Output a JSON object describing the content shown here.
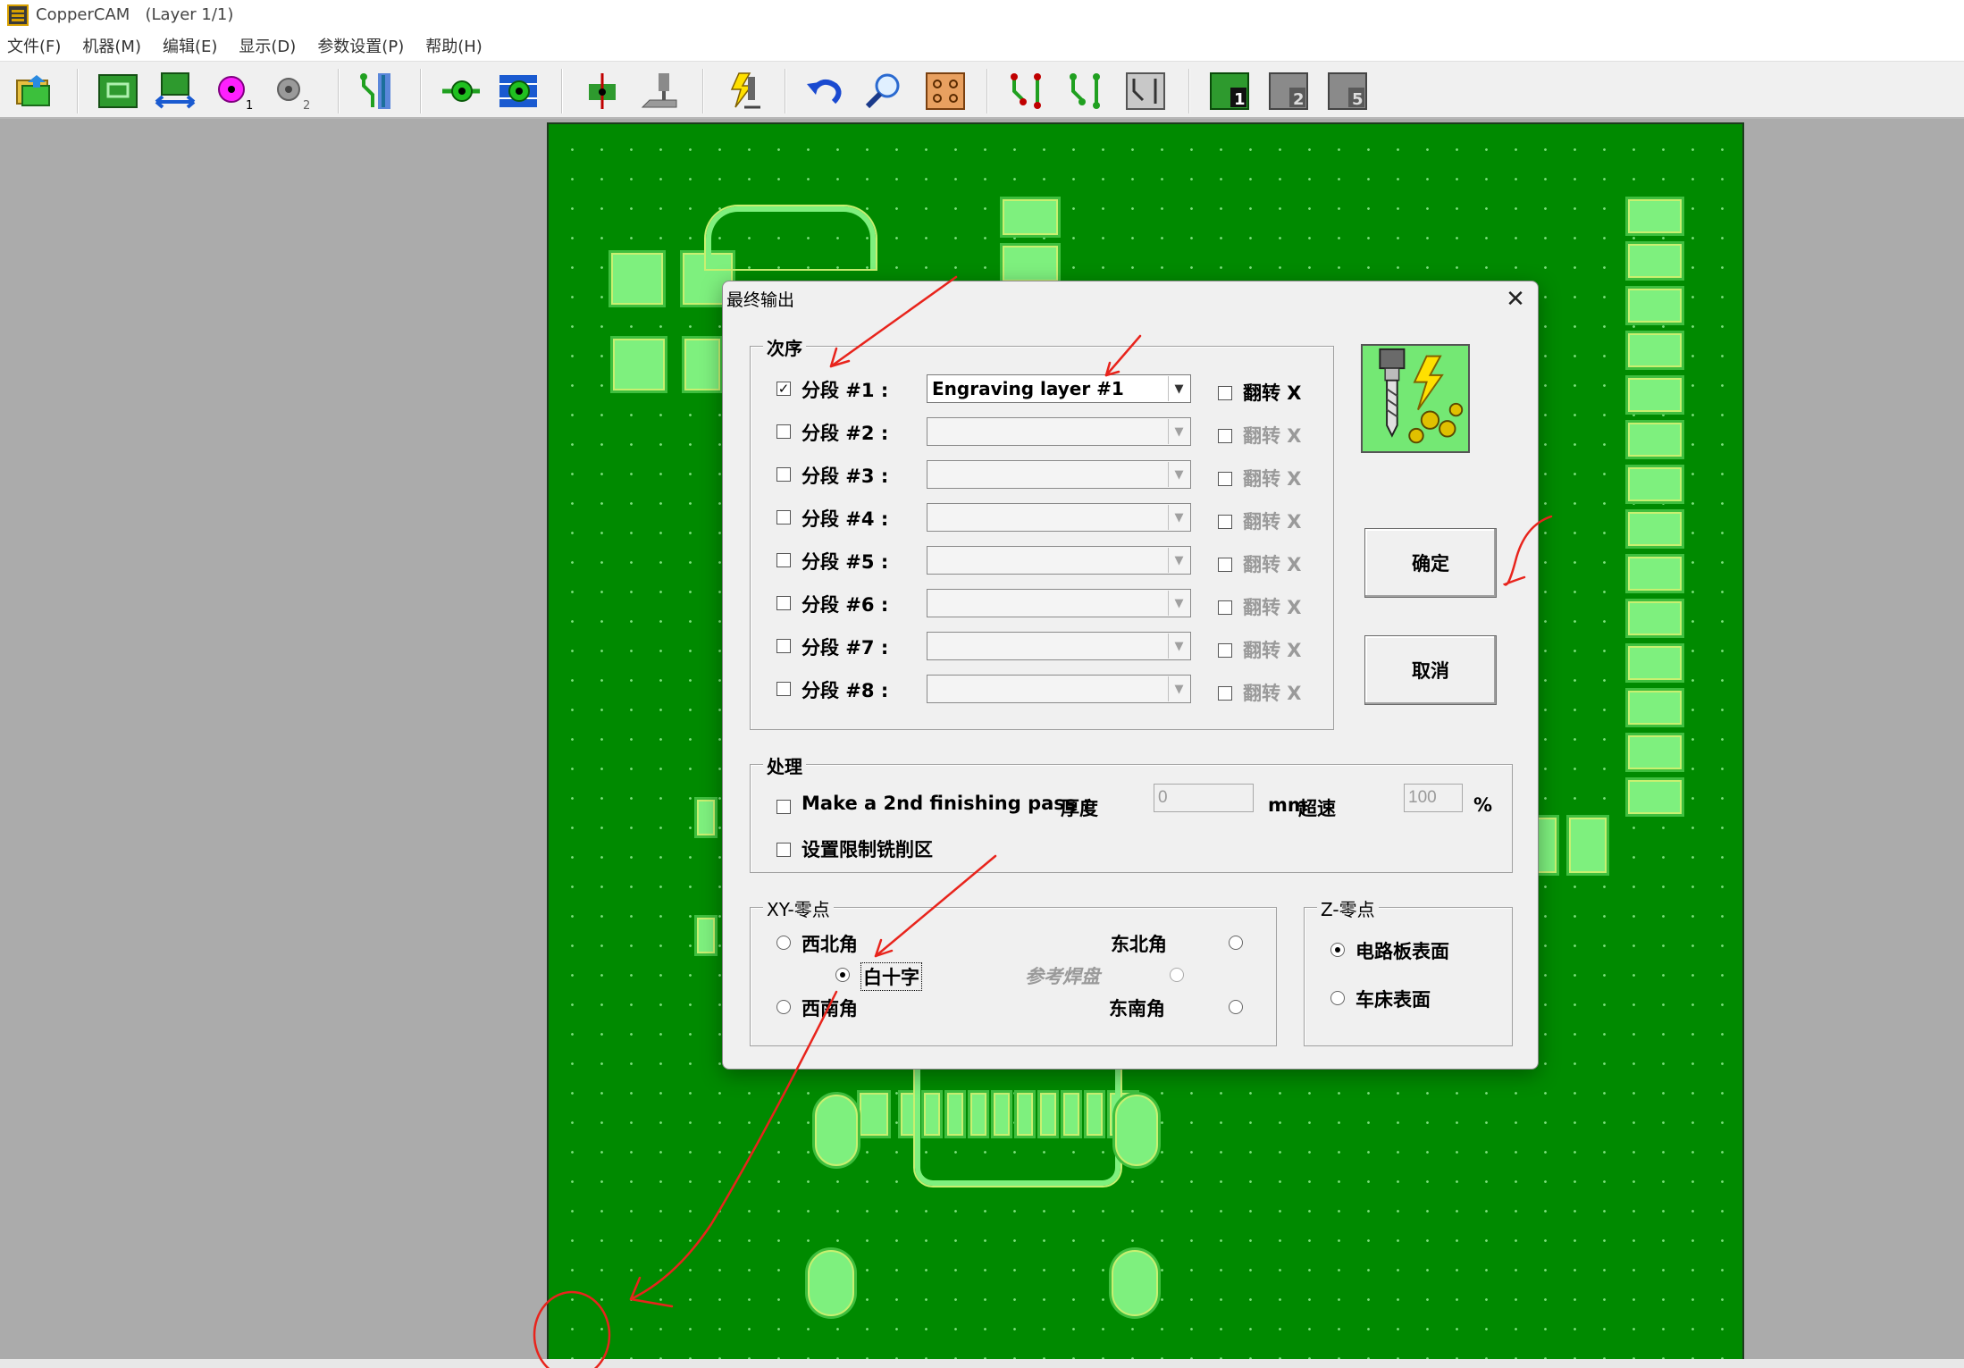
{
  "window": {
    "title": "CopperCAM   (Layer 1/1)"
  },
  "menu": [
    "文件(F)",
    "机器(M)",
    "编辑(E)",
    "显示(D)",
    "参数设置(P)",
    "帮助(H)"
  ],
  "toolbar": {
    "icons": [
      "open-folder-icon",
      "board-icon",
      "board-move-icon",
      "pad-1-icon",
      "pad-2-icon",
      "track-icon",
      "pad-drill-icon",
      "pad-contour-icon",
      "drill-icon",
      "mill-icon",
      "laser-output-icon",
      "undo-icon",
      "zoom-icon",
      "pcb-view-icon",
      "route-a-icon",
      "route-b-icon",
      "route-c-icon",
      "layer-1-icon",
      "layer-2-icon",
      "layer-5-icon"
    ],
    "badges": {
      "pad1": "1",
      "pad2": "2",
      "layer1": "1",
      "layer2": "2",
      "layer5": "5"
    }
  },
  "dialog": {
    "title": "最终输出",
    "close": "✕",
    "order_group": "次序",
    "sections": [
      {
        "label": "分段 #1 :",
        "checked": true,
        "value": "Engraving layer #1",
        "flip": "翻转 X",
        "enabled": true
      },
      {
        "label": "分段 #2 :",
        "checked": false,
        "value": "",
        "flip": "翻转 X",
        "enabled": false
      },
      {
        "label": "分段 #3 :",
        "checked": false,
        "value": "",
        "flip": "翻转 X",
        "enabled": false
      },
      {
        "label": "分段 #4 :",
        "checked": false,
        "value": "",
        "flip": "翻转 X",
        "enabled": false
      },
      {
        "label": "分段 #5 :",
        "checked": false,
        "value": "",
        "flip": "翻转 X",
        "enabled": false
      },
      {
        "label": "分段 #6 :",
        "checked": false,
        "value": "",
        "flip": "翻转 X",
        "enabled": false
      },
      {
        "label": "分段 #7 :",
        "checked": false,
        "value": "",
        "flip": "翻转 X",
        "enabled": false
      },
      {
        "label": "分段 #8 :",
        "checked": false,
        "value": "",
        "flip": "翻转 X",
        "enabled": false
      }
    ],
    "ok_button": "确定",
    "cancel_button": "取消",
    "process_group": "处理",
    "finishing_pass_label": "Make a 2nd finishing pass :",
    "thickness_label": "厚度",
    "thickness_value": "0",
    "thickness_unit": "mm",
    "overspeed_label": "超速",
    "overspeed_value": "100",
    "overspeed_unit": "%",
    "limit_area_label": "设置限制铣削区",
    "xy_group": "XY-零点",
    "xy_nw": "西北角",
    "xy_ne": "东北角",
    "xy_cross": "白十字",
    "xy_ref_pad": "参考焊盘",
    "xy_sw": "西南角",
    "xy_se": "东南角",
    "xy_selected": "白十字",
    "z_group": "Z-零点",
    "z_board": "电路板表面",
    "z_bed": "车床表面",
    "z_selected": "电路板表面"
  },
  "colors": {
    "board": "#008a00",
    "pad": "#7ef07e",
    "pad_outline": "#c8f070",
    "annotation": "#e8241c",
    "background": "#ababab"
  }
}
